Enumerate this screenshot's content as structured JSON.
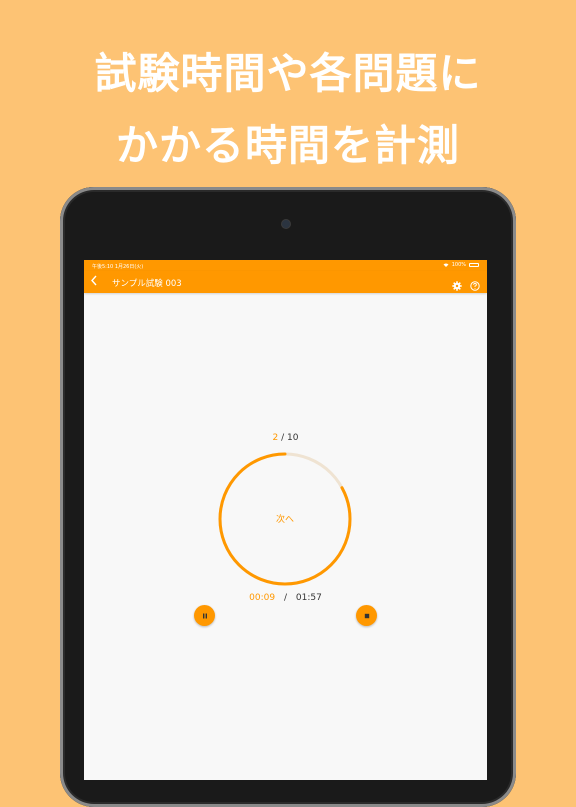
{
  "promo": {
    "line1": "試験時間や各問題に",
    "line2": "かかる時間を計測"
  },
  "status_bar": {
    "time": "午後5:10  1月26日(火)",
    "battery": "100%"
  },
  "nav": {
    "back_icon": "chevron-left-icon",
    "title": "サンプル試験 003",
    "settings_icon": "gear-icon",
    "help_icon": "question-circle-icon"
  },
  "progress": {
    "current": "2",
    "separator": "/",
    "total": "10",
    "ring_fraction": 0.83
  },
  "next_label": "次へ",
  "timer": {
    "elapsed": "00:09",
    "separator": "/",
    "total": "01:57"
  },
  "controls": {
    "pause_icon": "pause-icon",
    "stop_icon": "stop-icon"
  },
  "colors": {
    "accent": "#FF9800",
    "background": "#FDC374",
    "ring_track": "#EFE3D2"
  }
}
